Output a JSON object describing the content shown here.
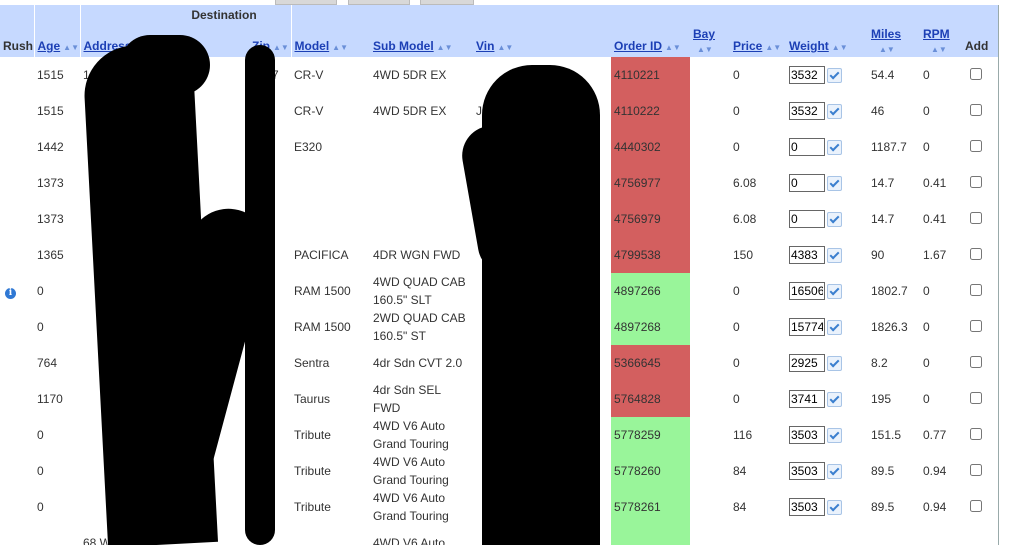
{
  "headers": {
    "rush": "Rush",
    "destination": "Destination",
    "age": "Age",
    "address": "Address",
    "zip": "Zip",
    "model": "Model",
    "sub_model": "Sub Model",
    "vin": "Vin",
    "order_id": "Order ID",
    "bay": "Bay",
    "price": "Price",
    "weight": "Weight",
    "miles": "Miles",
    "rpm": "RPM",
    "add": "Add"
  },
  "icons": {
    "sort": "sort-arrows-icon",
    "weight_confirm": "checkmark-icon",
    "info": "info-icon"
  },
  "colors": {
    "header_bg": "#c6d9ff",
    "order_red": "#d35f5f",
    "order_green": "#99f59a",
    "link": "#1c3fb5"
  },
  "rows": [
    {
      "rush_info": false,
      "age": "1515",
      "address": "107",
      "zip": "4817",
      "model": "CR-V",
      "sub_model": "4WD 5DR EX",
      "vin": "",
      "order_id": "4110221",
      "status": "red",
      "bay": "",
      "price": "0",
      "weight": "3532",
      "miles": "54.4",
      "rpm": "0"
    },
    {
      "rush_info": false,
      "age": "1515",
      "address": "",
      "zip": "",
      "model": "CR-V",
      "sub_model": "4WD 5DR EX",
      "vin": "J",
      "order_id": "4110222",
      "status": "red",
      "bay": "",
      "price": "0",
      "weight": "3532",
      "miles": "46",
      "rpm": "0"
    },
    {
      "rush_info": false,
      "age": "1442",
      "address": "",
      "zip": "",
      "model": "E320",
      "sub_model": "",
      "vin": "",
      "order_id": "4440302",
      "status": "red",
      "bay": "",
      "price": "0",
      "weight": "0",
      "miles": "1187.7",
      "rpm": "0"
    },
    {
      "rush_info": false,
      "age": "1373",
      "address": "",
      "zip": "",
      "model": "",
      "sub_model": "",
      "vin": "",
      "order_id": "4756977",
      "status": "red",
      "bay": "",
      "price": "6.08",
      "weight": "0",
      "miles": "14.7",
      "rpm": "0.41"
    },
    {
      "rush_info": false,
      "age": "1373",
      "address": "",
      "zip": "",
      "model": "",
      "sub_model": "",
      "vin": "",
      "order_id": "4756979",
      "status": "red",
      "bay": "",
      "price": "6.08",
      "weight": "0",
      "miles": "14.7",
      "rpm": "0.41"
    },
    {
      "rush_info": false,
      "age": "1365",
      "address": "",
      "zip": "",
      "model": "PACIFICA",
      "sub_model": "4DR WGN FWD",
      "vin": "",
      "order_id": "4799538",
      "status": "red",
      "bay": "",
      "price": "150",
      "weight": "4383",
      "miles": "90",
      "rpm": "1.67"
    },
    {
      "rush_info": true,
      "age": "0",
      "address": "",
      "zip": "",
      "model": "RAM 1500",
      "sub_model": "4WD QUAD CAB 160.5\" SLT",
      "vin": "",
      "order_id": "4897266",
      "status": "green",
      "bay": "",
      "price": "0",
      "weight": "16506",
      "miles": "1802.7",
      "rpm": "0"
    },
    {
      "rush_info": false,
      "age": "0",
      "address": "",
      "zip": "",
      "model": "RAM 1500",
      "sub_model": "2WD QUAD CAB 160.5\" ST",
      "vin": "",
      "order_id": "4897268",
      "status": "green",
      "bay": "",
      "price": "0",
      "weight": "15774",
      "miles": "1826.3",
      "rpm": "0"
    },
    {
      "rush_info": false,
      "age": "764",
      "address": "",
      "zip": "",
      "model": "Sentra",
      "sub_model": "4dr Sdn CVT 2.0",
      "vin": "",
      "order_id": "5366645",
      "status": "red",
      "bay": "",
      "price": "0",
      "weight": "2925",
      "miles": "8.2",
      "rpm": "0"
    },
    {
      "rush_info": false,
      "age": "1170",
      "address": "",
      "zip": "",
      "model": "Taurus",
      "sub_model": "4dr Sdn SEL FWD",
      "vin": "",
      "order_id": "5764828",
      "status": "red",
      "bay": "",
      "price": "0",
      "weight": "3741",
      "miles": "195",
      "rpm": "0"
    },
    {
      "rush_info": false,
      "age": "0",
      "address": "",
      "zip": "",
      "model": "Tribute",
      "sub_model": "4WD V6 Auto Grand Touring",
      "vin": "",
      "order_id": "5778259",
      "status": "green",
      "bay": "",
      "price": "116",
      "weight": "3503",
      "miles": "151.5",
      "rpm": "0.77"
    },
    {
      "rush_info": false,
      "age": "0",
      "address": "",
      "zip": "",
      "model": "Tribute",
      "sub_model": "4WD V6 Auto Grand Touring",
      "vin": "",
      "order_id": "5778260",
      "status": "green",
      "bay": "",
      "price": "84",
      "weight": "3503",
      "miles": "89.5",
      "rpm": "0.94"
    },
    {
      "rush_info": false,
      "age": "0",
      "address": "",
      "zip": "",
      "model": "Tribute",
      "sub_model": "4WD V6 Auto Grand Touring",
      "vin": "",
      "order_id": "5778261",
      "status": "green",
      "bay": "",
      "price": "84",
      "weight": "3503",
      "miles": "89.5",
      "rpm": "0.94"
    },
    {
      "rush_info": false,
      "age": "",
      "address": "68 W",
      "zip": "",
      "model": "",
      "sub_model": "4WD V6 Auto",
      "vin": "",
      "order_id": "",
      "status": "green",
      "bay": "",
      "price": "",
      "weight": "",
      "miles": "",
      "rpm": ""
    }
  ]
}
